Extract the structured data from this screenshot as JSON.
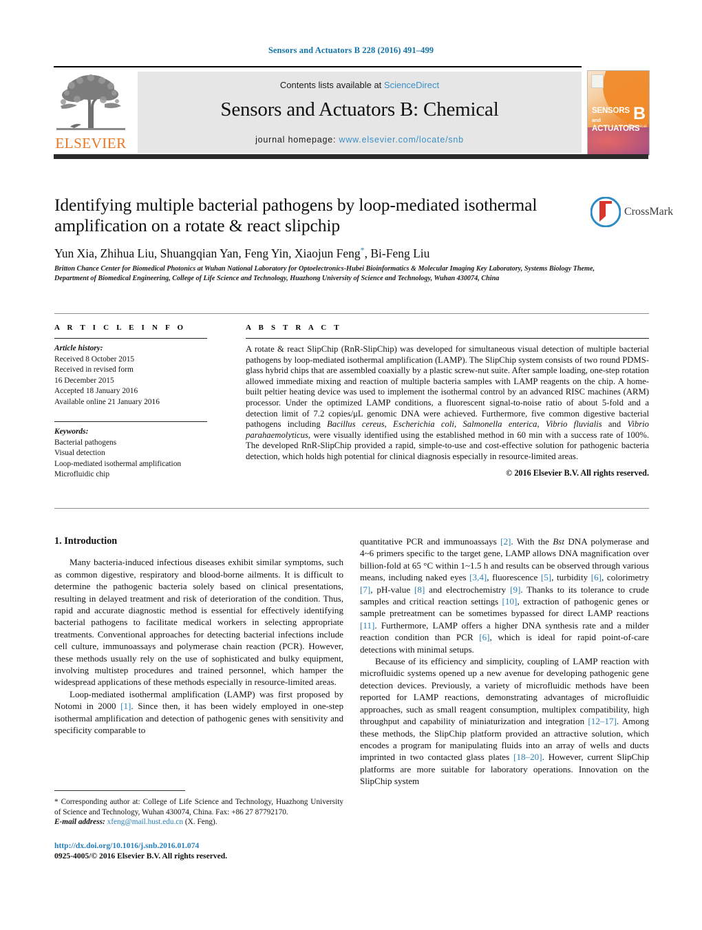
{
  "running_head": "Sensors and Actuators B 228 (2016) 491–499",
  "masthead": {
    "contents_prefix": "Contents lists available at ",
    "sciencedirect": "ScienceDirect",
    "journal_name": "Sensors and Actuators B: Chemical",
    "homepage_label": "journal homepage: ",
    "homepage_url": "www.elsevier.com/locate/snb",
    "publisher_wordmark": "ELSEVIER",
    "publisher_color": "#e87722",
    "link_color": "#3a8fc4",
    "cover": {
      "line1": "SENSORS",
      "and": "and",
      "line2": "ACTUATORS",
      "volume_letter": "B",
      "subtitle": "Chemical"
    }
  },
  "article": {
    "title": "Identifying multiple bacterial pathogens by loop-mediated isothermal amplification on a rotate & react slipchip",
    "authors": "Yun Xia, Zhihua Liu, Shuangqian Yan, Feng Yin, Xiaojun Feng",
    "authors_tail": ", Bi-Feng Liu",
    "corresponding_marker": "*",
    "affiliation": "Britton Chance Center for Biomedical Photonics at Wuhan National Laboratory for Optoelectronics-Hubei Bioinformatics & Molecular Imaging Key Laboratory, Systems Biology Theme, Department of Biomedical Engineering, College of Life Science and Technology, Huazhong University of Science and Technology, Wuhan 430074, China",
    "crossmark_label": "CrossMark"
  },
  "article_info": {
    "heading": "A R T I C L E   I N F O",
    "history_label": "Article history:",
    "history": [
      "Received 8 October 2015",
      "Received in revised form",
      "16 December 2015",
      "Accepted 18 January 2016",
      "Available online 21 January 2016"
    ],
    "keywords_label": "Keywords:",
    "keywords": [
      "Bacterial pathogens",
      "Visual detection",
      "Loop-mediated isothermal amplification",
      "Microfluidic chip"
    ]
  },
  "abstract": {
    "heading": "A B S T R A C T",
    "paragraph_1": "A rotate & react SlipChip (RnR-SlipChip) was developed for simultaneous visual detection of multiple bacterial pathogens by loop-mediated isothermal amplification (LAMP). The SlipChip system consists of two round PDMS-glass hybrid chips that are assembled coaxially by a plastic screw-nut suite. After sample loading, one-step rotation allowed immediate mixing and reaction of multiple bacteria samples with LAMP reagents on the chip. A home-built peltier heating device was used to implement the isothermal control by an advanced RISC machines (ARM) processor. Under the optimized LAMP conditions, a fluorescent signal-to-noise ratio of about 5-fold and a detection limit of 7.2 copies/μL genomic DNA were achieved. Furthermore, five common digestive bacterial pathogens including ",
    "italic_1": "Bacillus cereus, Escherichia coli, Salmonella enterica, Vibrio fluvialis",
    "mid_1": " and ",
    "italic_2": "Vibrio parahaemolyticus",
    "paragraph_1_tail": ", were visually identified using the established method in 60 min with a success rate of 100%. The developed RnR-SlipChip provided a rapid, simple-to-use and cost-effective solution for pathogenic bacteria detection, which holds high potential for clinical diagnosis especially in resource-limited areas.",
    "copyright": "© 2016 Elsevier B.V. All rights reserved."
  },
  "body": {
    "section_heading": "1.  Introduction",
    "left_paragraph_1": "Many bacteria-induced infectious diseases exhibit similar symptoms, such as common digestive, respiratory and blood-borne ailments. It is difficult to determine the pathogenic bacteria solely based on clinical presentations, resulting in delayed treatment and risk of deterioration of the condition. Thus, rapid and accurate diagnostic method is essential for effectively identifying bacterial pathogens to facilitate medical workers in selecting appropriate treatments. Conventional approaches for detecting bacterial infections include cell culture, immunoassays and polymerase chain reaction (PCR). However, these methods usually rely on the use of sophisticated and bulky equipment, involving multistep procedures and trained personnel, which hamper the widespread applications of these methods especially in resource-limited areas.",
    "left_paragraph_2_a": "Loop-mediated isothermal amplification (LAMP) was first proposed by Notomi in 2000 ",
    "left_ref_1": "[1]",
    "left_paragraph_2_b": ". Since then, it has been widely employed in one-step isothermal amplification and detection of pathogenic genes with sensitivity and specificity comparable to",
    "right_paragraph_1_a": "quantitative PCR and immunoassays ",
    "right_ref_2": "[2]",
    "right_paragraph_1_b": ". With the ",
    "right_italic_bst": "Bst",
    "right_paragraph_1_c": " DNA polymerase and 4~6 primers specific to the target gene, LAMP allows DNA magnification over billion-fold at 65 °C within 1~1.5 h and results can be observed through various means, including naked eyes ",
    "right_ref_34": "[3,4]",
    "right_paragraph_1_d": ", fluorescence ",
    "right_ref_5": "[5]",
    "right_paragraph_1_e": ", turbidity ",
    "right_ref_6": "[6]",
    "right_paragraph_1_f": ", colorimetry ",
    "right_ref_7": "[7]",
    "right_paragraph_1_g": ", pH-value ",
    "right_ref_8": "[8]",
    "right_paragraph_1_h": " and electrochemistry ",
    "right_ref_9": "[9]",
    "right_paragraph_1_i": ". Thanks to its tolerance to crude samples and critical reaction settings ",
    "right_ref_10": "[10]",
    "right_paragraph_1_j": ", extraction of pathogenic genes or sample pretreatment can be sometimes bypassed for direct LAMP reactions ",
    "right_ref_11": "[11]",
    "right_paragraph_1_k": ". Furthermore, LAMP offers a higher DNA synthesis rate and a milder reaction condition than PCR ",
    "right_ref_6b": "[6]",
    "right_paragraph_1_l": ", which is ideal for rapid point-of-care detections with minimal setups.",
    "right_paragraph_2_a": "Because of its efficiency and simplicity, coupling of LAMP reaction with microfluidic systems opened up a new avenue for developing pathogenic gene detection devices. Previously, a variety of microfluidic methods have been reported for LAMP reactions, demonstrating advantages of microfluidic approaches, such as small reagent consumption, multiplex compatibility, high throughput and capability of miniaturization and integration ",
    "right_ref_1217": "[12–17]",
    "right_paragraph_2_b": ". Among these methods, the SlipChip platform provided an attractive solution, which encodes a program for manipulating fluids into an array of wells and ducts imprinted in two contacted glass plates ",
    "right_ref_1820": "[18–20]",
    "right_paragraph_2_c": ". However, current SlipChip platforms are more suitable for laboratory operations. Innovation on the SlipChip system"
  },
  "footer": {
    "corresponding_star": "*",
    "corresponding_text": " Corresponding author at: College of Life Science and Technology, Huazhong University of Science and Technology, Wuhan 430074, China. Fax: +86 27 87792170.",
    "email_label": "E-mail address:",
    "email": "xfeng@mail.hust.edu.cn",
    "email_owner": " (X. Feng).",
    "doi": "http://dx.doi.org/10.1016/j.snb.2016.01.074",
    "issn_line": "0925-4005/© 2016 Elsevier B.V. All rights reserved."
  }
}
